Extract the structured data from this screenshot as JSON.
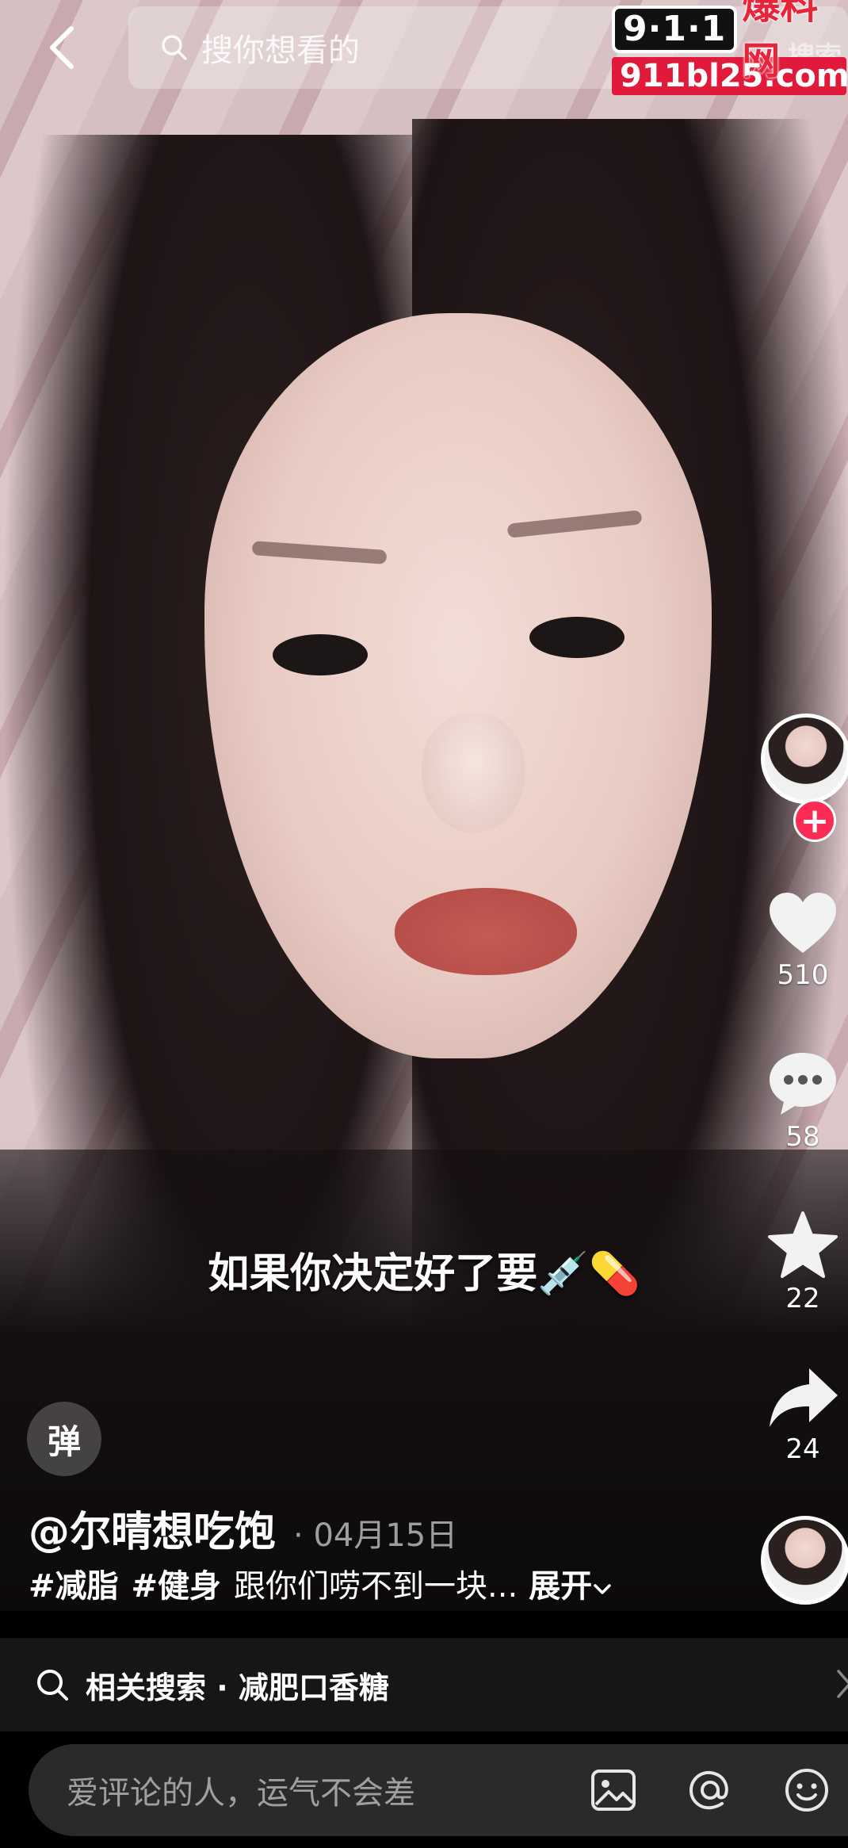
{
  "search": {
    "placeholder": "搜你想看的",
    "action_label": "搜索"
  },
  "watermark": {
    "badge": "9·1·1",
    "brand": "爆料网",
    "url": "911bl25.com"
  },
  "actions": {
    "likes": "510",
    "comments": "58",
    "favorites": "22",
    "shares": "24"
  },
  "video": {
    "subtitle": "如果你决定好了要💉💊"
  },
  "danmu": {
    "label": "弹"
  },
  "post": {
    "author": "@尔晴想吃饱",
    "date": "· 04月15日",
    "tags": [
      "#减脂",
      "#健身"
    ],
    "description": "跟你们唠不到一块...",
    "expand_label": "展开"
  },
  "related_search": {
    "label": "相关搜索 · 减肥口香糖"
  },
  "comment": {
    "placeholder": "爱评论的人，运气不会差"
  },
  "colors": {
    "follow_accent": "#fe2c55",
    "watermark_red": "#e1193a"
  },
  "icons": [
    "back-arrow-icon",
    "search-icon",
    "heart-icon",
    "comment-icon",
    "star-icon",
    "share-icon",
    "image-icon",
    "at-icon",
    "emoji-icon",
    "chevron-down-icon",
    "chevron-right-icon"
  ]
}
